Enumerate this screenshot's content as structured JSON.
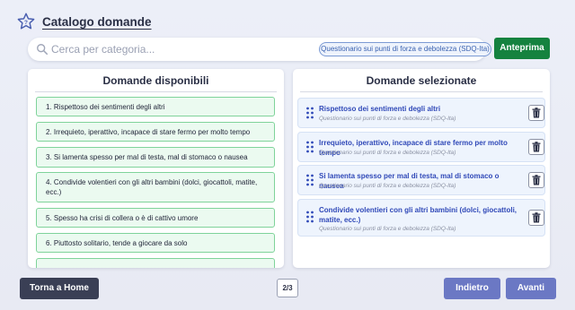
{
  "header": {
    "title": "Catalogo domande",
    "icon": "star-icon"
  },
  "search": {
    "placeholder": "Cerca per categoria...",
    "value": "",
    "filter_chip": "Questionario sui punti di forza e debolezza (SDQ-Ita)",
    "clear_icon": "close-circle-icon"
  },
  "toolbar": {
    "preview_label": "Anteprima"
  },
  "available": {
    "title": "Domande disponibili",
    "items": [
      {
        "label": "1. Rispettoso dei sentimenti degli altri"
      },
      {
        "label": "2. Irrequieto, iperattivo, incapace di stare fermo per molto tempo"
      },
      {
        "label": "3. Si lamenta spesso per mal di testa, mal di stomaco o nausea"
      },
      {
        "label": "4. Condivide volentieri con gli altri bambini (dolci, giocattoli, matite, ecc.)"
      },
      {
        "label": "5. Spesso ha crisi di collera o è di cattivo umore"
      },
      {
        "label": "6. Piuttosto solitario, tende a giocare da solo"
      },
      {
        "label": ""
      }
    ]
  },
  "selected": {
    "title": "Domande selezionate",
    "items": [
      {
        "title": "Rispettoso dei sentimenti degli altri",
        "category": "Questionario sui punti di forza e debolezza (SDQ-Ita)"
      },
      {
        "title": "Irrequieto, iperattivo, incapace di stare fermo per molto tempo",
        "category": "Questionario sui punti di forza e debolezza (SDQ-Ita)"
      },
      {
        "title": "Si lamenta spesso per mal di testa, mal di stomaco o nausea",
        "category": "Questionario sui punti di forza e debolezza (SDQ-Ita)"
      },
      {
        "title": "Condivide volentieri con gli altri bambini (dolci, giocattoli, matite, ecc.)",
        "category": "Questionario sui punti di forza e debolezza (SDQ-Ita)"
      }
    ]
  },
  "footer": {
    "home_label": "Torna a Home",
    "page": "2/3",
    "back_label": "Indietro",
    "next_label": "Avanti"
  },
  "colors": {
    "accent_green": "#15823f",
    "accent_indigo": "#6b78c4",
    "dark_button": "#3a3f55",
    "selected_title": "#3049b8"
  }
}
